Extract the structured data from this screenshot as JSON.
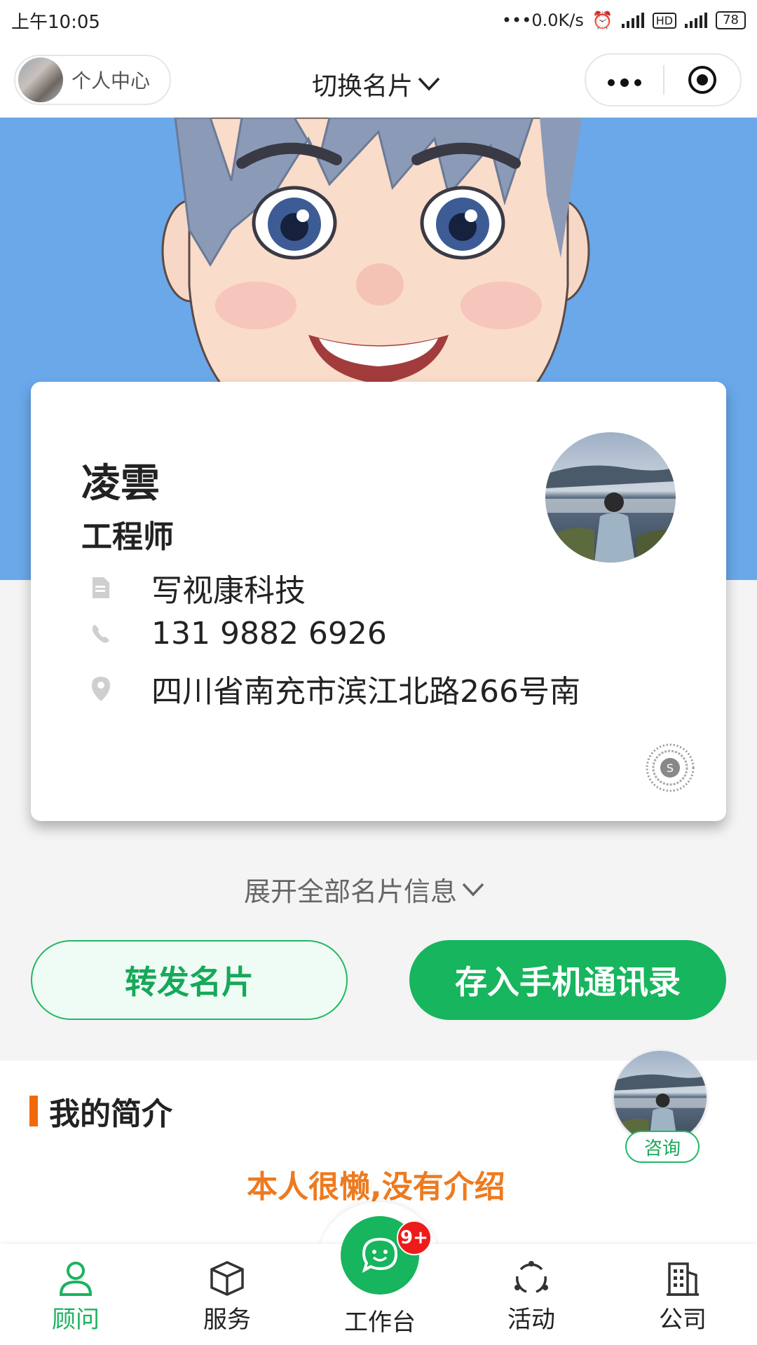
{
  "status_bar": {
    "time": "上午10:05",
    "network_speed": "0.0K/s",
    "battery": "78"
  },
  "nav": {
    "personal_center": "个人中心",
    "title": "切换名片"
  },
  "card": {
    "name": "凌雲",
    "job_title": "工程师",
    "company": "写视康科技",
    "phone": "131 9882 6926",
    "address": "四川省南充市滨江北路266号南"
  },
  "expand_label": "展开全部名片信息",
  "actions": {
    "forward": "转发名片",
    "save_contact": "存入手机通讯录"
  },
  "intro": {
    "title": "我的简介",
    "text": "本人很懒,没有介绍",
    "consult": "咨询"
  },
  "tabbar": {
    "items": [
      {
        "label": "顾问",
        "icon": "person-icon",
        "active": true
      },
      {
        "label": "服务",
        "icon": "box-icon",
        "active": false
      },
      {
        "label": "工作台",
        "icon": "chat-icon",
        "active": false
      },
      {
        "label": "活动",
        "icon": "activity-icon",
        "active": false
      },
      {
        "label": "公司",
        "icon": "building-icon",
        "active": false
      }
    ],
    "badge": "9+"
  },
  "colors": {
    "accent_green": "#17b55d",
    "orange": "#ee7a1f",
    "hero_blue": "#6aa8ea",
    "badge_red": "#ee1b1b"
  }
}
